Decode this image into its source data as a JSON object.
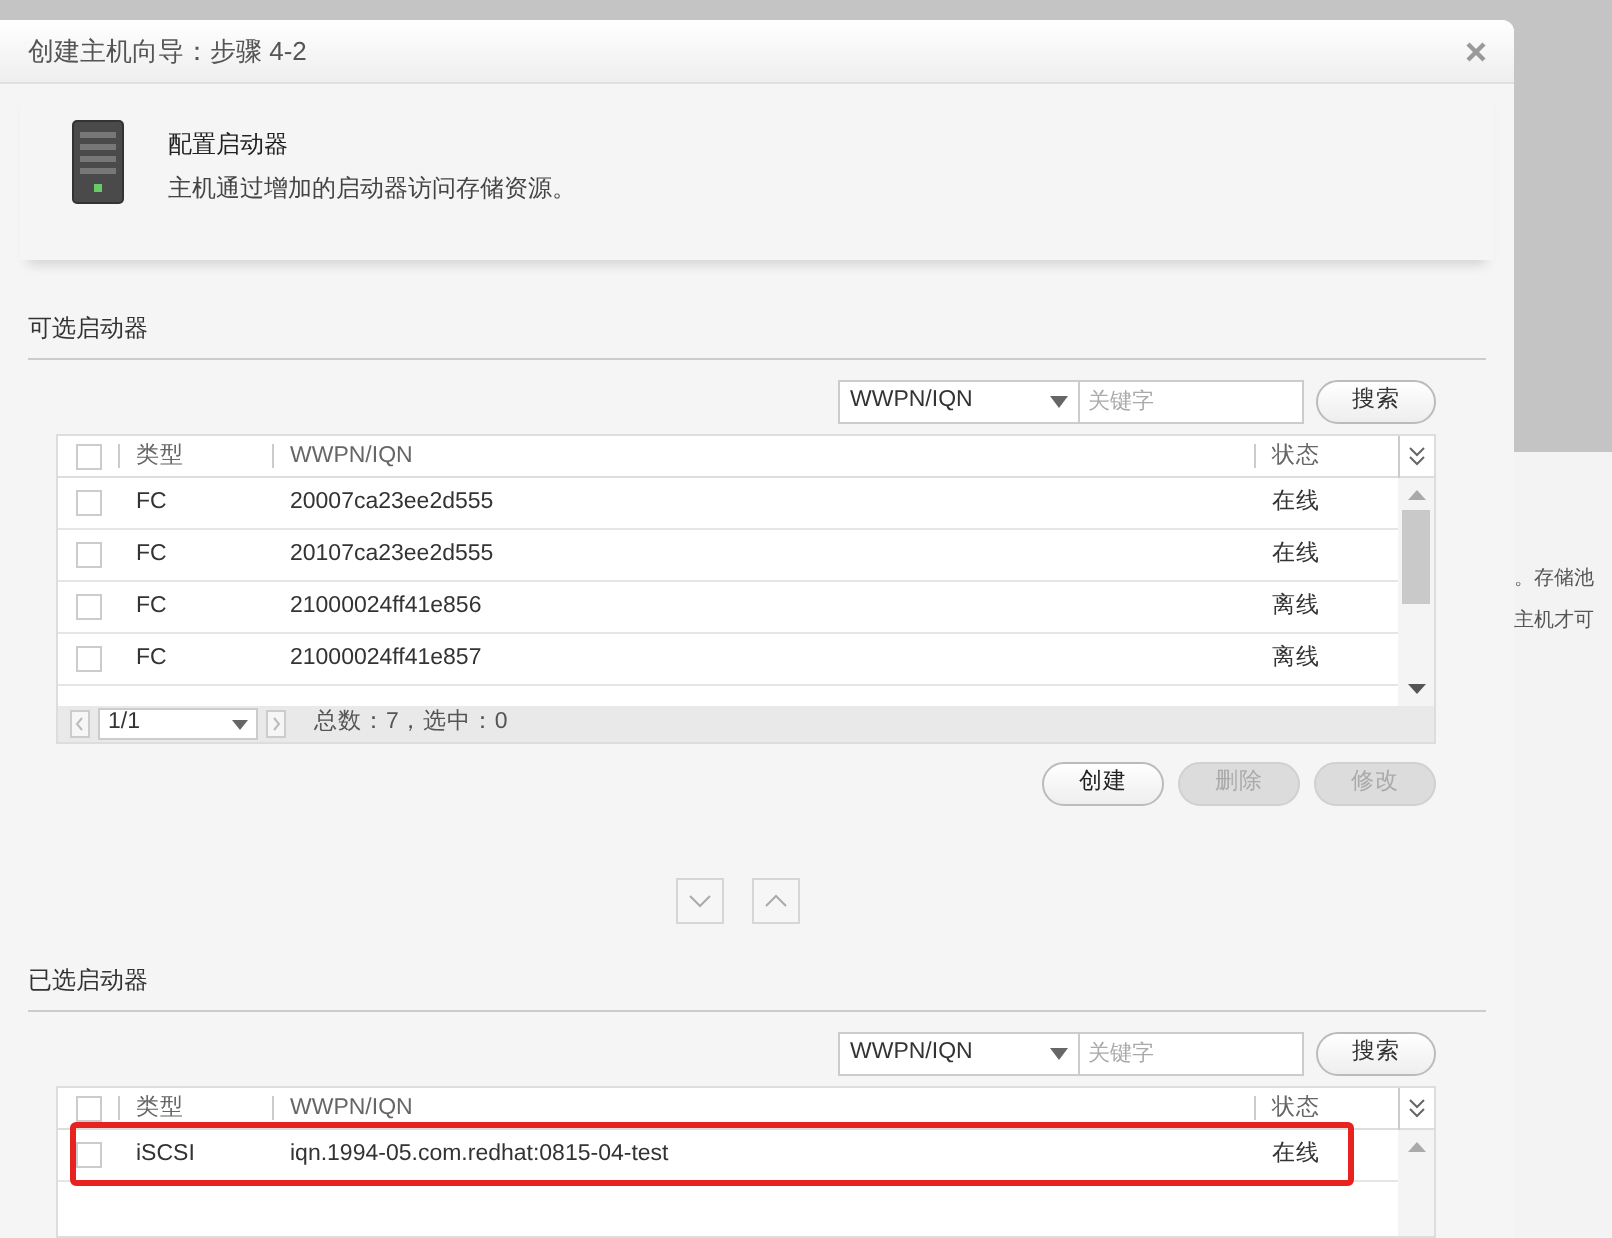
{
  "window": {
    "title": "创建主机向导：步骤 4-2"
  },
  "header": {
    "title": "配置启动器",
    "description": "主机通过增加的启动器访问存储资源。"
  },
  "available": {
    "title": "可选启动器",
    "search": {
      "field": "WWPN/IQN",
      "placeholder": "关键字",
      "button": "搜索"
    },
    "columns": [
      "类型",
      "WWPN/IQN",
      "状态"
    ],
    "select_all_checked": false,
    "rows": [
      {
        "type": "FC",
        "id": "20007ca23ee2d555",
        "status": "在线",
        "checked": false
      },
      {
        "type": "FC",
        "id": "20107ca23ee2d555",
        "status": "在线",
        "checked": false
      },
      {
        "type": "FC",
        "id": "21000024ff41e856",
        "status": "离线",
        "checked": false
      },
      {
        "type": "FC",
        "id": "21000024ff41e857",
        "status": "离线",
        "checked": false
      }
    ],
    "pager": {
      "page": "1/1",
      "summary": "总数：7，选中：0"
    },
    "actions": [
      {
        "label": "创建",
        "disabled": false
      },
      {
        "label": "删除",
        "disabled": true
      },
      {
        "label": "修改",
        "disabled": true
      }
    ]
  },
  "selected_section": {
    "title": "已选启动器",
    "search": {
      "field": "WWPN/IQN",
      "placeholder": "关键字",
      "button": "搜索"
    },
    "columns": [
      "类型",
      "WWPN/IQN",
      "状态"
    ],
    "select_all_checked": false,
    "rows": [
      {
        "type": "iSCSI",
        "id": "iqn.1994-05.com.redhat:0815-04-test",
        "status": "在线",
        "checked": false,
        "highlighted": true
      }
    ]
  },
  "background_text": [
    "。存储池",
    "主机才可"
  ]
}
